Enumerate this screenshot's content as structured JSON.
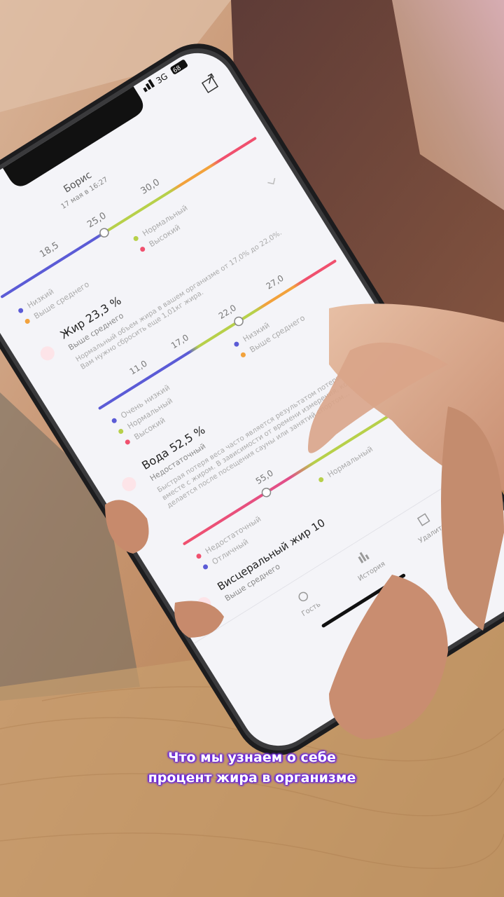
{
  "status_bar": {
    "network": "3G",
    "battery": "68"
  },
  "header": {
    "name": "Борис",
    "date": "17 мая в 16:27"
  },
  "scale_top": {
    "ticks": [
      "18,5",
      "25,0",
      "30,0"
    ],
    "legend": [
      "Низкий",
      "Нормальный",
      "Выше среднего",
      "Высокий"
    ]
  },
  "fat": {
    "title": "Жир 23,3 %",
    "status": "Выше среднего",
    "description": "Нормальный объем жира в вашем организме от 17,0% до 22,0%. Вам нужно сбросить еще 1,01кг жира.",
    "ticks": [
      "11,0",
      "17,0",
      "22,0",
      "27,0"
    ],
    "legend": [
      "Очень низкий",
      "Низкий",
      "Нормальный",
      "Выше среднего",
      "Высокий"
    ]
  },
  "water": {
    "title": "Вода 52,5 %",
    "status": "Недостаточный",
    "description": "Быстрая потеря веса часто является результатом потери воды вместе с жиром. В зависимости от времени измерения, которое делается после посещения сауны или занятий спортом...",
    "ticks": [
      "55,0"
    ],
    "legend": [
      "Недостаточный",
      "Отличный",
      "Нормальный"
    ]
  },
  "visceral": {
    "title": "Висцеральный жир 10",
    "status": "Выше среднего"
  },
  "tab_bar": {
    "items": [
      "Гость",
      "История",
      "Удалить"
    ]
  },
  "captions": {
    "line1": "Что мы узнаем о себе",
    "line2": "процент жира в организме"
  },
  "colors": {
    "accent": "#6c2bd9",
    "blue": "#5b5bd6",
    "green": "#b7d04a",
    "orange": "#f2a23c",
    "red": "#f0506e"
  }
}
